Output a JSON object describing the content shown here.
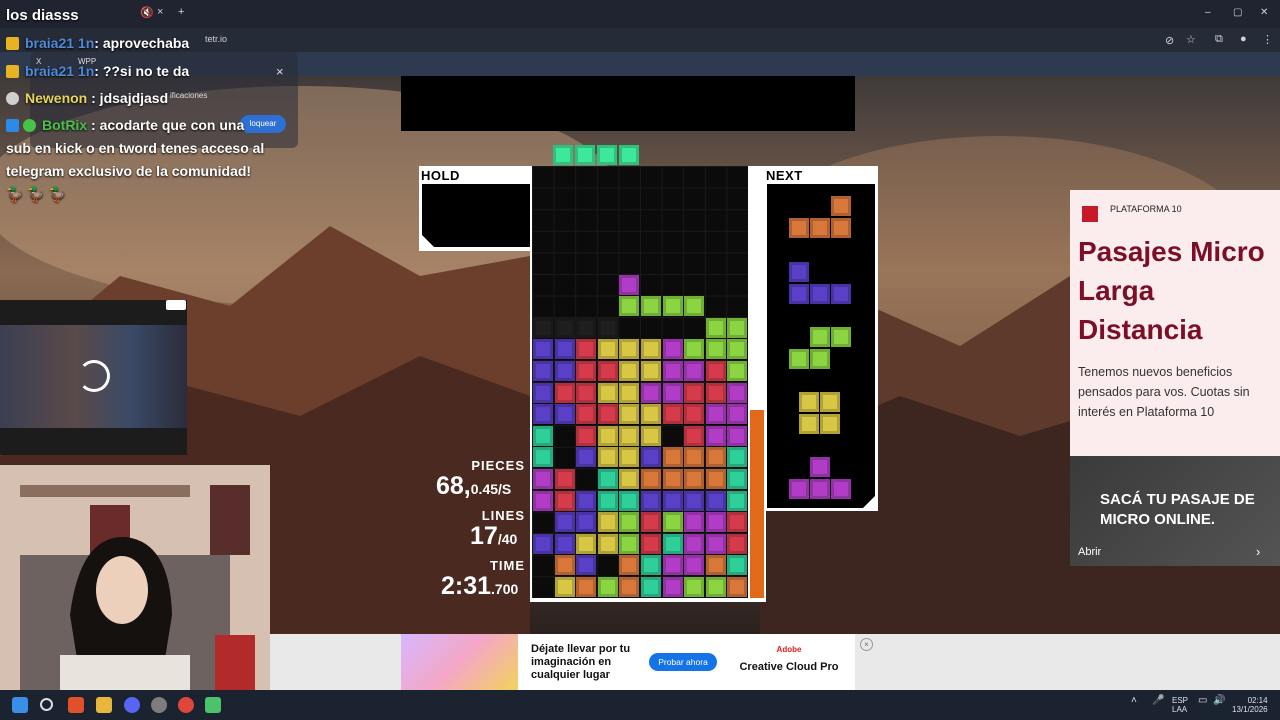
{
  "browser": {
    "url": "tetr.io",
    "notif_tab": "@",
    "bookmark_x": "X",
    "bookmark_wpp": "WPP",
    "notif_snippet": "ificaciones",
    "notif_button": "loquear",
    "notif_close": "×"
  },
  "chat": {
    "title": "los diasss",
    "lines": [
      {
        "user": "braia21 1n",
        "msg": ": aprovechaba"
      },
      {
        "user": "braia21 1n",
        "msg": ": ??si no te da"
      },
      {
        "user": "Newenon",
        "msg": " : jdsajdjasd"
      },
      {
        "user": "BotRix",
        "msg": " : acodarte que con una"
      }
    ],
    "continuation": "sub en kick o en tword tenes acceso al telegram exclusivo de la comunidad! 🦆 🦆 🦆",
    "colors": {
      "braia": "#4f8ad6",
      "newenon": "#e7d65a",
      "botrix": "#49c24a"
    }
  },
  "game": {
    "hold_label": "HOLD",
    "next_label": "NEXT",
    "pieces_label": "PIECES",
    "pieces_value": "68,",
    "pieces_rate": "0.45/S",
    "lines_label": "LINES",
    "lines_value": "17",
    "lines_target": "/40",
    "time_label": "TIME",
    "time_value": "2:31",
    "time_ms": ".700",
    "colors": {
      "I": "#3ee89b",
      "O": "#d8c645",
      "T": "#b13dc7",
      "S": "#8bd442",
      "Z": "#d63b4c",
      "J": "#5a3fc7",
      "L": "#d8773a",
      "G": "#2fcf9a"
    }
  },
  "ad_right": {
    "brand": "PLATAFORMA 10",
    "headline": "Pasajes Micro Larga Distancia",
    "body": "Tenemos nuevos beneficios pensados para vos. Cuotas sin interés en Plataforma 10",
    "banner": "SACÁ TU PASAJE DE MICRO ONLINE.",
    "cta": "Abrir",
    "chevron": "›"
  },
  "ad_bottom": {
    "text": "Déjate llevar por tu imaginación en cualquier lugar",
    "button": "Probar ahora",
    "brand": "Adobe",
    "product": "Creative Cloud Pro",
    "close": "×"
  },
  "taskbar": {
    "lang_top": "ESP",
    "lang_bottom": "LAA",
    "time": "02:14",
    "date": "13/1/2026"
  }
}
